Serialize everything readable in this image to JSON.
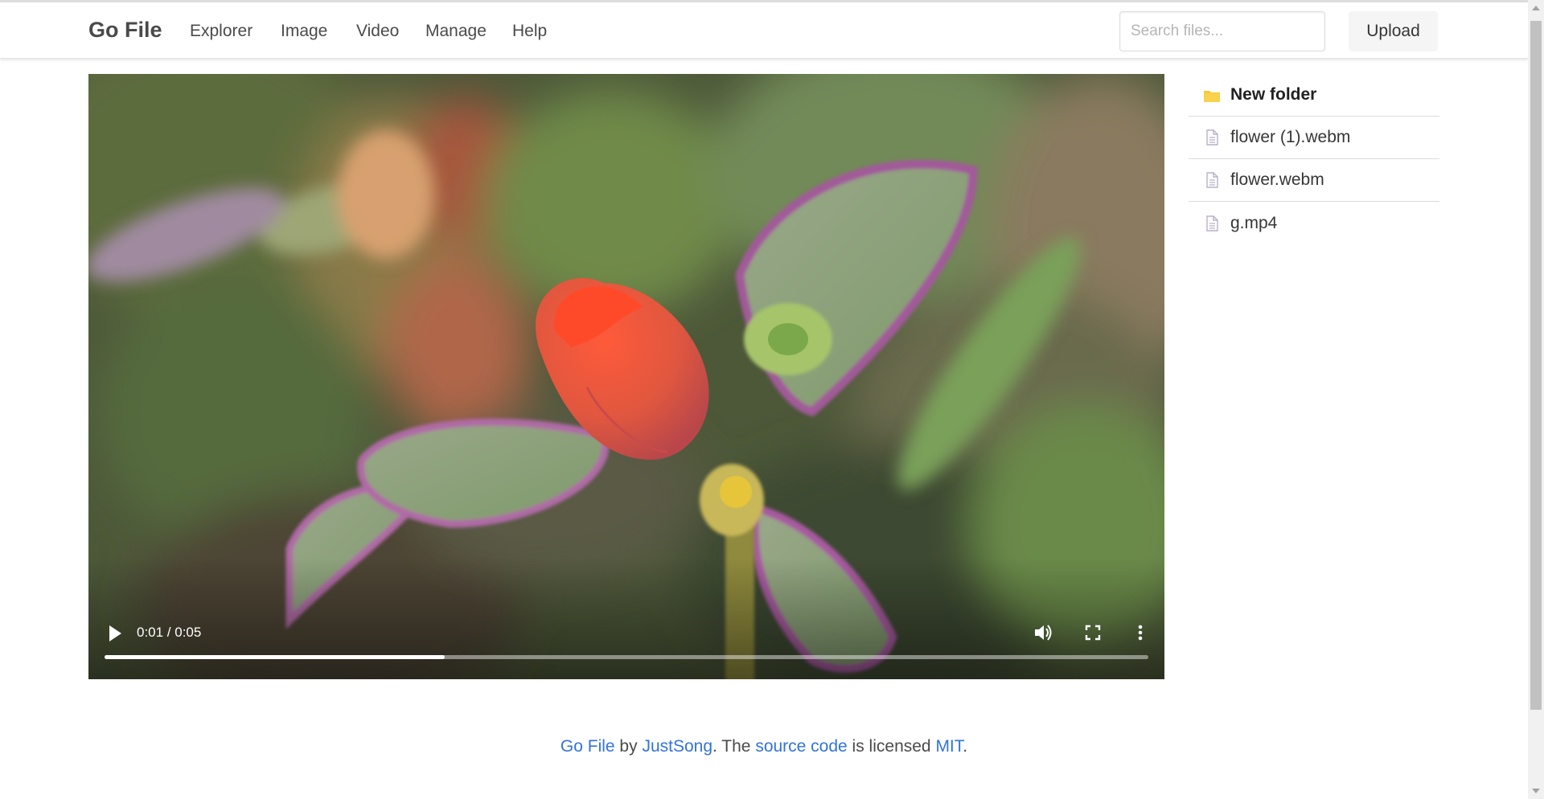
{
  "navbar": {
    "brand": "Go File",
    "items": [
      "Explorer",
      "Image",
      "Video",
      "Manage",
      "Help"
    ],
    "search_placeholder": "Search files...",
    "upload_label": "Upload"
  },
  "player": {
    "time": "0:01 / 0:05",
    "progress": 0.326,
    "icons": [
      "play-icon",
      "volume-icon",
      "fullscreen-icon",
      "more-options-icon"
    ]
  },
  "files": [
    {
      "name": "New folder",
      "type": "folder"
    },
    {
      "name": "flower (1).webm",
      "type": "file"
    },
    {
      "name": "flower.webm",
      "type": "file"
    },
    {
      "name": "g.mp4",
      "type": "file"
    }
  ],
  "footer": {
    "app_link": "Go File",
    "by": " by ",
    "author_link": "JustSong",
    "text_mid": ". The ",
    "source_link": "source code",
    "text_licensed": " is licensed ",
    "license_link": "MIT",
    "text_end": "."
  },
  "colors": {
    "link": "#3273dc",
    "folder": "#f5c93b",
    "file_icon": "#b8b0c8"
  }
}
